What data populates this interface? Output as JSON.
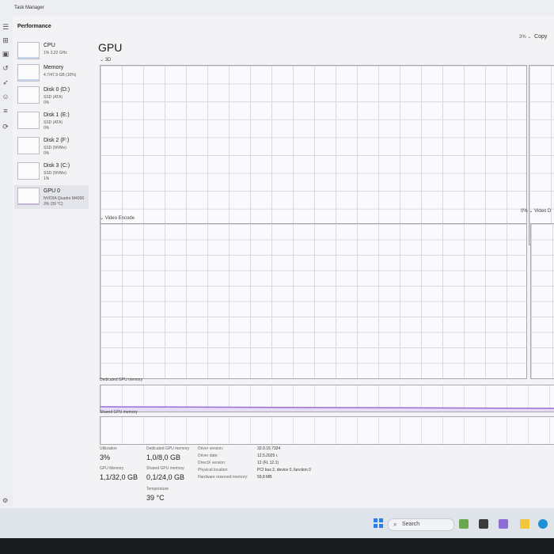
{
  "window": {
    "title": "Task Manager"
  },
  "nav": {
    "section_title": "Performance"
  },
  "devices": [
    {
      "name": "CPU",
      "line1": "1% 3,22 GHz",
      "line2": ""
    },
    {
      "name": "Memory",
      "line1": "4,7/47,9 GB (10%)",
      "line2": ""
    },
    {
      "name": "Disk 0 (D:)",
      "line1": "SSD (ATA)",
      "line2": "0%"
    },
    {
      "name": "Disk 1 (E:)",
      "line1": "SSD (ATA)",
      "line2": "0%"
    },
    {
      "name": "Disk 2 (F:)",
      "line1": "SSD (NVMe)",
      "line2": "0%"
    },
    {
      "name": "Disk 3 (C:)",
      "line1": "SSD (NVMe)",
      "line2": "1%"
    },
    {
      "name": "GPU 0",
      "line1": "NVIDIA Quadro M4000",
      "line2": "3% (39 °C)"
    }
  ],
  "main": {
    "title": "GPU",
    "top_right_pct": "3%",
    "copy_label": "Copy",
    "graph_3d_label": "3D",
    "graph_3d_right_pct": "0%",
    "graph_ve_label": "Video Encode",
    "graph_ve_right_label": "Video D",
    "dedicated_label": "Dedicated GPU memory",
    "shared_label": "Shared GPU memory"
  },
  "stats": {
    "utilization_label": "Utilization",
    "utilization_value": "3%",
    "dedicated_label": "Dedicated GPU memory",
    "dedicated_value": "1,0/8,0 GB",
    "gpu_memory_label": "GPU Memory",
    "gpu_memory_value": "1,1/32,0 GB",
    "shared_label": "Shared GPU memory",
    "shared_value": "0,1/24,0 GB",
    "temperature_label": "Temperature",
    "temperature_value": "39 °C"
  },
  "info": [
    {
      "label": "Driver version:",
      "value": "32.0.15.7324"
    },
    {
      "label": "Driver date:",
      "value": "12.5.2025 г."
    },
    {
      "label": "DirectX version:",
      "value": "12 (FL 12.1)"
    },
    {
      "label": "Physical location:",
      "value": "PCI bus 2, device 0, function 0"
    },
    {
      "label": "Hardware reserved memory:",
      "value": "59,8 MB"
    }
  ],
  "taskbar": {
    "search_text": "Search"
  },
  "chart_data": {
    "type": "area",
    "series": [
      {
        "values": [
          1,
          1,
          1,
          1,
          1,
          1,
          1,
          1,
          1,
          1,
          1,
          1,
          1,
          1,
          1,
          1,
          1,
          2,
          3,
          3,
          2,
          2,
          2,
          3,
          5,
          2,
          2,
          2,
          2,
          2,
          2,
          2,
          2,
          2,
          2,
          2,
          2,
          2,
          2,
          2,
          2,
          2,
          2,
          2,
          2,
          3,
          3,
          3,
          4,
          3,
          4,
          5,
          4,
          4,
          3,
          3,
          3,
          4,
          4,
          3,
          3,
          4,
          5,
          6,
          5,
          5,
          4,
          4,
          4,
          5,
          5,
          4,
          4,
          4,
          4,
          4,
          4,
          4,
          4,
          5
        ]
      }
    ],
    "ylim": [
      0,
      100
    ],
    "colors": {
      "line": "#9b6cd4",
      "fill": "#c3a8ea"
    }
  }
}
